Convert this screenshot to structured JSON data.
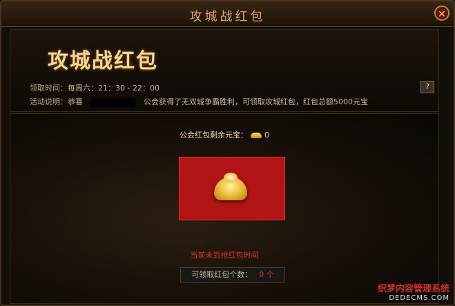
{
  "window": {
    "title": "攻城战红包",
    "close_icon": "close-icon"
  },
  "header": {
    "big_title": "攻城战红包",
    "time_label": "领取时间：",
    "time_value": "每周六：21：30 - 22：00",
    "desc_label": "活动说明：",
    "desc_prefix": "恭喜",
    "desc_suffix": "公会获得了无双城争霸胜利，可领取攻城红包，红包总额5000元宝",
    "help_label": "?"
  },
  "main": {
    "remain_label": "公会红包剩余元宝：",
    "remain_value": "0",
    "status_text": "当前未到抢红包时间",
    "count_label": "可领取红包个数：",
    "count_value": "0 个"
  },
  "watermark": {
    "line1": "织梦内容管理系统",
    "line2": "DEDECMS.COM"
  }
}
